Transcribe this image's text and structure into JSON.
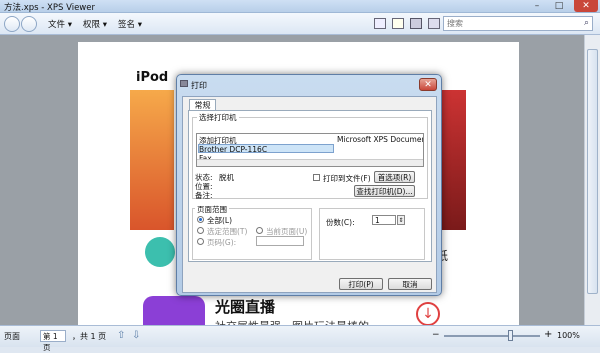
{
  "window": {
    "title": "方法.xps - XPS Viewer",
    "min": "–",
    "max": "□",
    "close": "✕"
  },
  "toolbar": {
    "menus": [
      "文件 ▾",
      "权限 ▾",
      "签名 ▾"
    ],
    "search_placeholder": "搜索"
  },
  "document": {
    "ipod": "iPod",
    "big_title": "光圈直播",
    "subtitle": "社交属性最强，图片玩法最棒的",
    "side_text": "纸"
  },
  "dialog": {
    "title": "打印",
    "close": "✕",
    "tab": "常规",
    "select_printer_label": "选择打印机",
    "printers": [
      "添加打印机",
      "Brother DCP-116C",
      "Fax",
      "Microsoft XPS Document Writer"
    ],
    "status_label": "状态:",
    "status_value": "脱机",
    "location_label": "位置:",
    "comment_label": "备注:",
    "print_to_file": "打印到文件(F)",
    "preferences_button": "首选项(R)",
    "find_printer_button": "查找打印机(D)...",
    "page_range_label": "页面范围",
    "all": "全部(L)",
    "selection": "选定范围(T)",
    "current_page": "当前页面(U)",
    "pages": "页码(G):",
    "copies_label": "份数(C):",
    "copies_value": "1",
    "print_button": "打印(P)",
    "cancel_button": "取消"
  },
  "statusbar": {
    "page_label": "页面",
    "page_number": "第 1 页",
    "page_total": "，共 1 页",
    "zoom": "100%"
  },
  "colors": {
    "accent": "#3cbfae",
    "purple": "#8b3fd6",
    "red": "#e04040"
  }
}
